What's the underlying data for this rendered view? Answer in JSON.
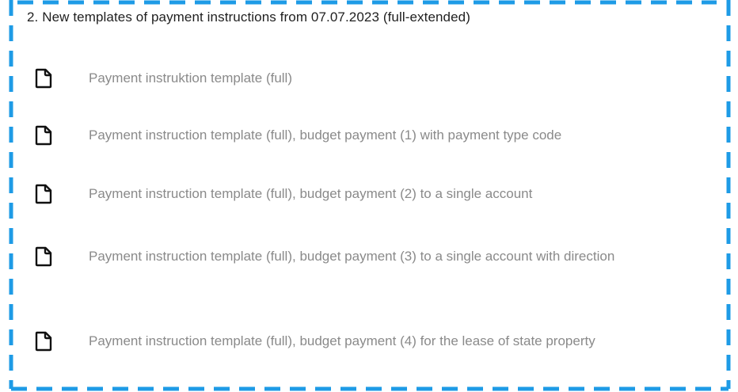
{
  "section": {
    "heading": "2. New templates of payment instructions from 07.07.2023 (full-extended)",
    "accent_color": "#1e9be6",
    "items": [
      {
        "icon": "document-icon",
        "label": "Payment instruktion template (full)"
      },
      {
        "icon": "document-icon",
        "label": "Payment instruction template (full), budget payment (1) with payment type code"
      },
      {
        "icon": "document-icon",
        "label": "Payment instruction template (full), budget payment (2) to a single account"
      },
      {
        "icon": "document-icon",
        "label": "Payment instruction template (full), budget payment (3) to a single account with direction"
      },
      {
        "icon": "document-icon",
        "label": "Payment instruction template (full), budget payment (4) for the lease of state property"
      }
    ]
  }
}
